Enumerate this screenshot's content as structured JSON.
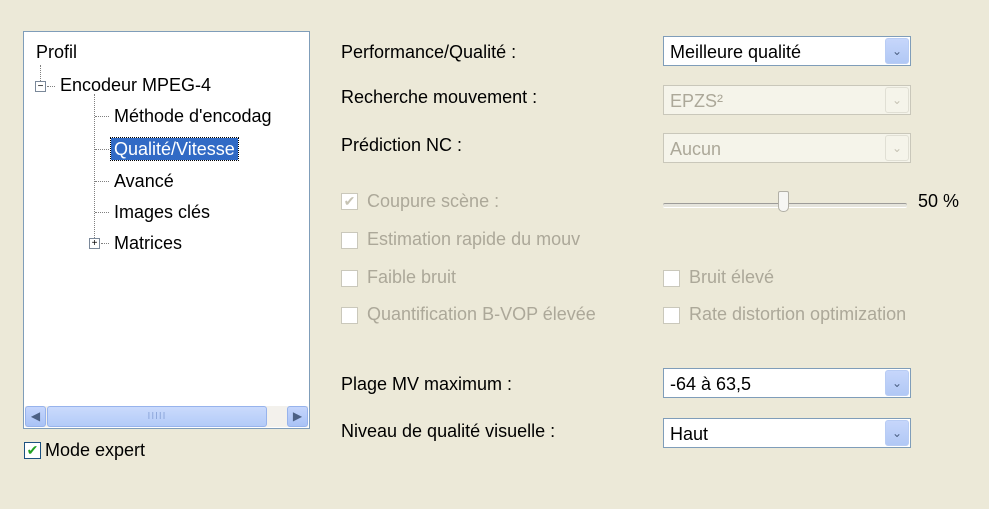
{
  "tree": {
    "root_label": "Profil",
    "items": [
      {
        "label": "Encodeur MPEG-4"
      },
      {
        "label": "Méthode d'encodag"
      },
      {
        "label": "Qualité/Vitesse"
      },
      {
        "label": "Avancé"
      },
      {
        "label": "Images clés"
      },
      {
        "label": "Matrices"
      }
    ],
    "scroll_left_icon": "◀",
    "scroll_right_icon": "▶",
    "scroll_grip": "IIIII"
  },
  "expert_mode": {
    "label": "Mode expert",
    "checked": true
  },
  "settings": {
    "performance": {
      "label": "Performance/Qualité :",
      "value": "Meilleure qualité"
    },
    "motion_search": {
      "label": "Recherche mouvement :",
      "value": "EPZS²"
    },
    "nc_prediction": {
      "label": "Prédiction NC :",
      "value": "Aucun"
    },
    "scene_cut": {
      "label": "Coupure scène :",
      "checked": true,
      "slider_value": "50 %",
      "slider_fraction": 0.5
    },
    "fast_motion_estimation": {
      "label": "Estimation rapide du mouv"
    },
    "low_noise": {
      "label": "Faible bruit"
    },
    "high_noise": {
      "label": "Bruit élevé"
    },
    "bvop_quant": {
      "label": "Quantification B-VOP élevée"
    },
    "rate_distortion": {
      "label": "Rate distortion optimization"
    },
    "mv_range": {
      "label": "Plage MV maximum :",
      "value": "-64 à 63,5"
    },
    "visual_quality": {
      "label": "Niveau de qualité visuelle :",
      "value": "Haut"
    }
  },
  "icons": {
    "check": "✔",
    "chevron": "⌄",
    "minus": "−",
    "plus": "+"
  },
  "colors": {
    "background": "#ECE9D8",
    "selection": "#316AC5",
    "border": "#7F9DB9",
    "check": "#21A121"
  }
}
